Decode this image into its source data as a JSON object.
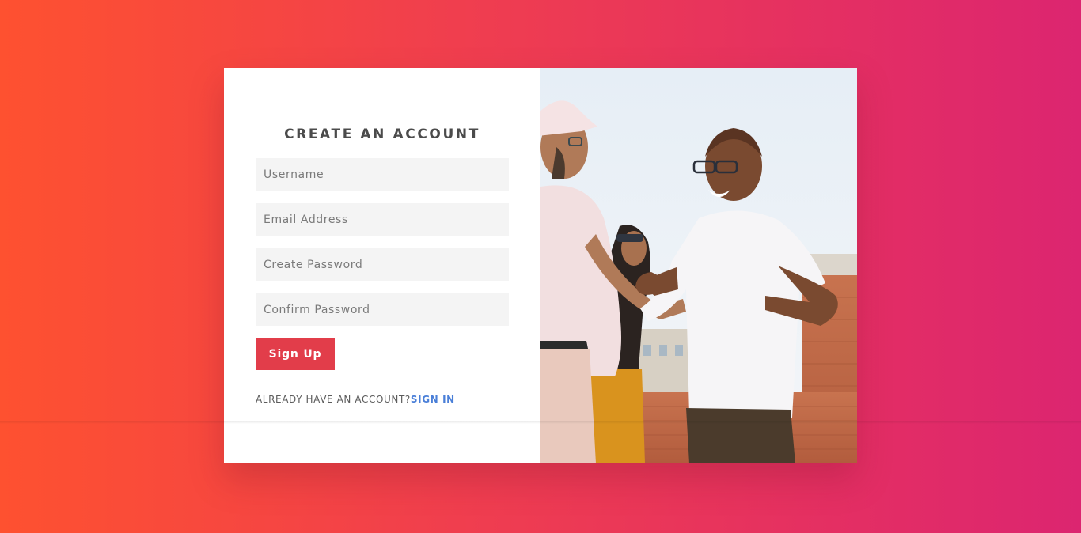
{
  "form": {
    "title": "CREATE AN ACCOUNT",
    "fields": [
      {
        "name": "username",
        "placeholder": "Username",
        "value": ""
      },
      {
        "name": "email",
        "placeholder": "Email Address",
        "value": ""
      },
      {
        "name": "create_password",
        "placeholder": "Create Password",
        "value": ""
      },
      {
        "name": "confirm_password",
        "placeholder": "Confirm Password",
        "value": ""
      }
    ],
    "submit_label": "Sign Up",
    "signin_prompt": "ALREADY HAVE AN ACCOUNT?",
    "signin_link": "SIGN IN"
  },
  "colors": {
    "background_start": "#fe5130",
    "background_end": "#dc2570",
    "button": "#e23d4a",
    "link": "#4a7fd8"
  }
}
